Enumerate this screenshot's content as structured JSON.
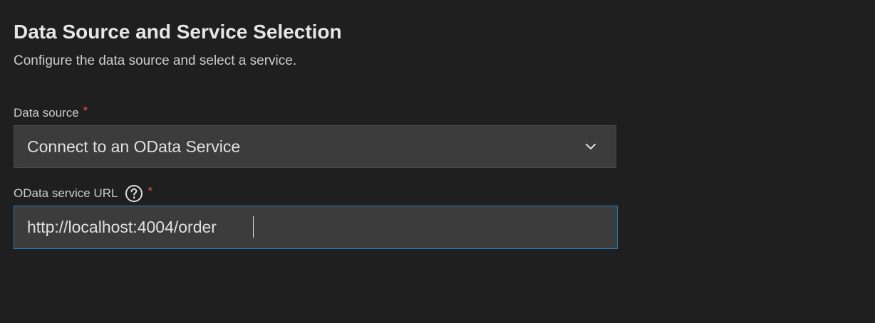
{
  "header": {
    "title": "Data Source and Service Selection",
    "subtitle": "Configure the data source and select a service."
  },
  "data_source": {
    "label": "Data source",
    "required_mark": "*",
    "selected_value": "Connect to an OData Service",
    "icon": "chevron-down-icon"
  },
  "service_url": {
    "label": "OData service URL",
    "required_mark": "*",
    "help_icon": "question-circle-icon",
    "value": "http://localhost:4004/order"
  },
  "colors": {
    "background": "#1f1f1f",
    "field_background": "#3c3c3c",
    "focus_border": "#1e7fc6",
    "required": "#f14c4c"
  }
}
